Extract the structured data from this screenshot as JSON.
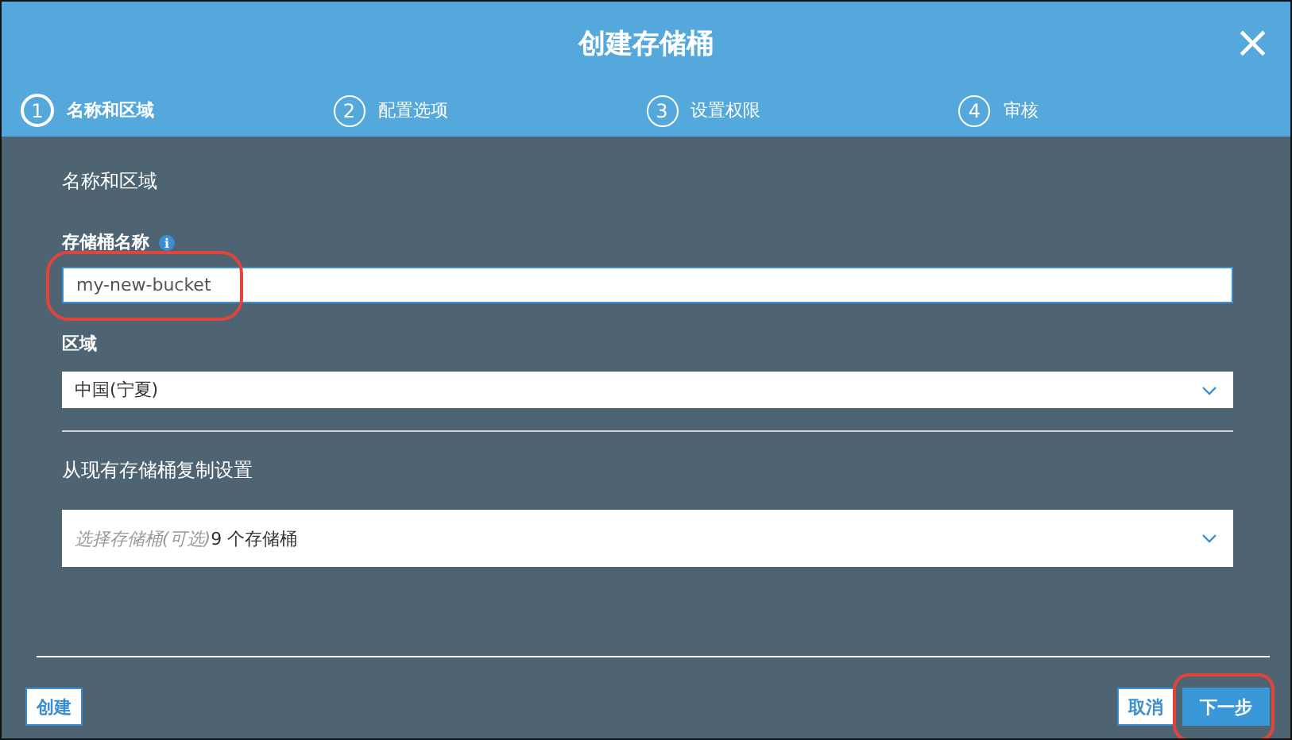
{
  "dialog": {
    "title": "创建存储桶",
    "close": "×"
  },
  "steps": [
    {
      "number": "1",
      "label": "名称和区域",
      "selected": true
    },
    {
      "number": "2",
      "label": "配置选项",
      "selected": false
    },
    {
      "number": "3",
      "label": "设置权限",
      "selected": false
    },
    {
      "number": "4",
      "label": "审核",
      "selected": false
    }
  ],
  "section_title": "名称和区域",
  "bucket_name": {
    "label": "存储桶名称",
    "info": "i",
    "value": "my-new-bucket",
    "highlighted": true
  },
  "region": {
    "label": "区域",
    "value": "中国(宁夏)"
  },
  "copy_settings": {
    "title": "从现有存储桶复制设置",
    "placeholder": "选择存储桶(可选)",
    "count": "9 个存储桶"
  },
  "buttons": [
    {
      "label": "创建",
      "kind": "outline",
      "highlighted": false
    },
    {
      "label": "取消",
      "kind": "outline",
      "highlighted": false
    },
    {
      "label": "下一步",
      "kind": "primary",
      "highlighted": true
    }
  ]
}
